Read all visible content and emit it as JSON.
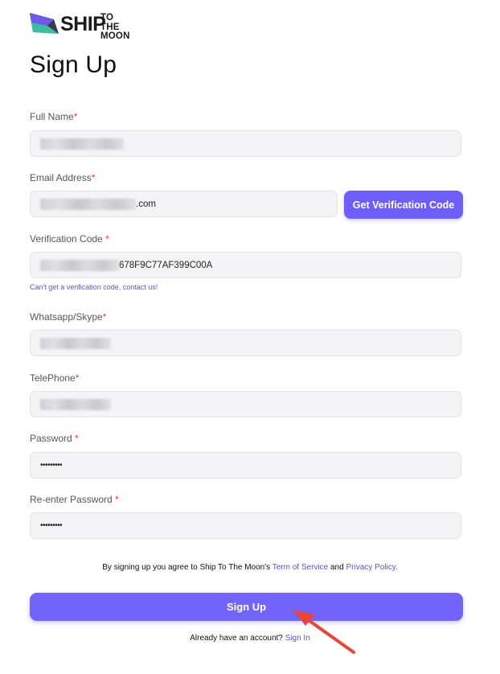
{
  "logo": {
    "word1": "SHIP",
    "line1": "TO THE",
    "line2": "MOON"
  },
  "page": {
    "title": "Sign Up"
  },
  "form": {
    "full_name": {
      "label": "Full Name",
      "required": "*"
    },
    "email": {
      "label": "Email Address",
      "required": "*",
      "visible_suffix": ".com",
      "button": "Get Verification Code"
    },
    "verification": {
      "label": "Verification Code ",
      "required": "*",
      "visible_suffix": "678F9C77AF399C00A",
      "help_link": "Can't get a verification code, contact us!"
    },
    "whatsapp": {
      "label": "Whatsapp/Skype",
      "required": "*"
    },
    "telephone": {
      "label": "TelePhone",
      "required": "*"
    },
    "password": {
      "label": "Password ",
      "required": "*",
      "mask": "•••••••••"
    },
    "reenter": {
      "label": "Re-enter Password ",
      "required": "*",
      "mask": "•••••••••"
    }
  },
  "agree": {
    "prefix": "By signing up you agree to Ship To The Moon's ",
    "terms": "Term of Service",
    "and": " and ",
    "privacy": "Privacy Policy."
  },
  "submit_label": "Sign Up",
  "signin": {
    "prefix": "Already have an account? ",
    "link": "Sign In"
  },
  "colors": {
    "accent": "#6e5efb",
    "required": "#e23b3b",
    "link": "#5b52d6",
    "annotation_arrow": "#e8453c"
  },
  "annotation": {
    "type": "arrow",
    "target": "sign-up-button"
  }
}
